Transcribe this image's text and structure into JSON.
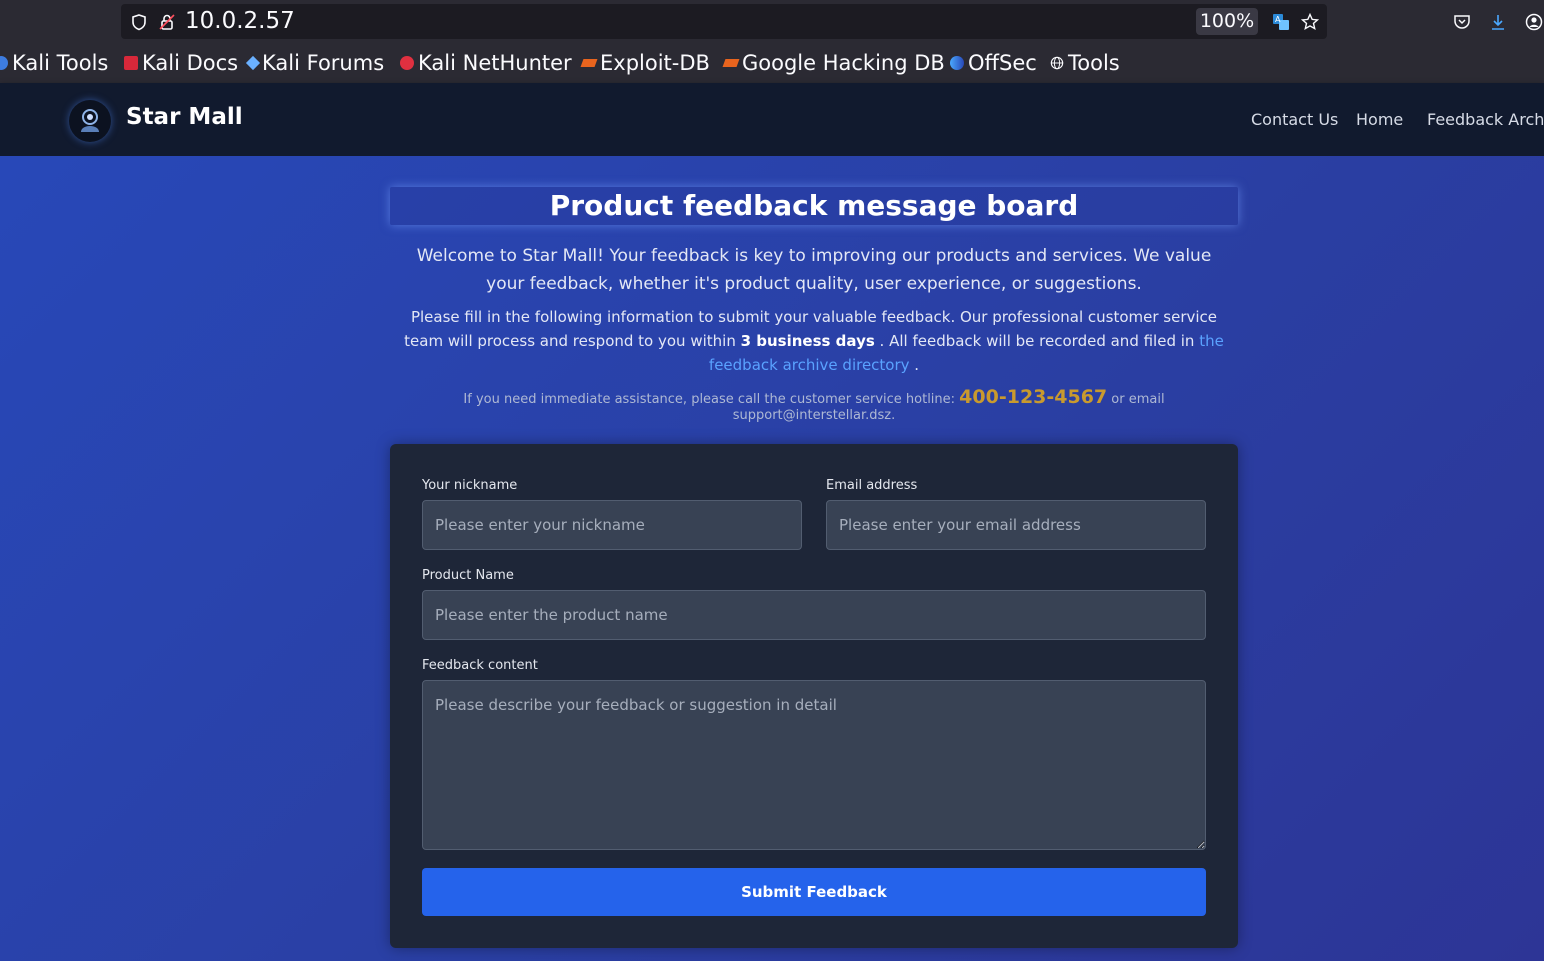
{
  "browser": {
    "url": "10.0.2.57",
    "zoom": "100%",
    "bookmarks": [
      {
        "label": "Kali Tools",
        "icon": "kali-icon"
      },
      {
        "label": "Kali Docs",
        "icon": "kali-docs-icon"
      },
      {
        "label": "Kali Forums",
        "icon": "kali-forums-icon"
      },
      {
        "label": "Kali NetHunter",
        "icon": "nethunter-icon"
      },
      {
        "label": "Exploit-DB",
        "icon": "exploitdb-icon"
      },
      {
        "label": "Google Hacking DB",
        "icon": "ghdb-icon"
      },
      {
        "label": "OffSec",
        "icon": "offsec-icon"
      },
      {
        "label": "Tools",
        "icon": "globe-icon"
      }
    ]
  },
  "site": {
    "brand": "Star Mall",
    "nav": [
      "Contact Us",
      "Home",
      "Feedback Archive"
    ]
  },
  "main": {
    "title": "Product feedback message board",
    "intro": "Welcome to Star Mall! Your feedback is key to improving our products and services. We value your feedback, whether it's product quality, user experience, or suggestions.",
    "info_prefix": "Please fill in the following information to submit your valuable feedback. Our professional customer service team will process and respond to you within ",
    "info_bold": "3 business days",
    "info_middle": " . All feedback will be recorded and filed in ",
    "info_link": "the feedback archive directory",
    "info_suffix": " .",
    "hotline_prefix": "If you need immediate assistance, please call the customer service hotline: ",
    "hotline_number": "400-123-4567",
    "hotline_suffix": " or email support@interstellar.dsz."
  },
  "form": {
    "nickname_label": "Your nickname",
    "nickname_placeholder": "Please enter your nickname",
    "email_label": "Email address",
    "email_placeholder": "Please enter your email address",
    "product_label": "Product Name",
    "product_placeholder": "Please enter the product name",
    "content_label": "Feedback content",
    "content_placeholder": "Please describe your feedback or suggestion in detail",
    "submit_label": "Submit Feedback"
  },
  "colors": {
    "accent": "#2563eb",
    "phone": "#c99a2e",
    "link": "#5aa2ff"
  }
}
